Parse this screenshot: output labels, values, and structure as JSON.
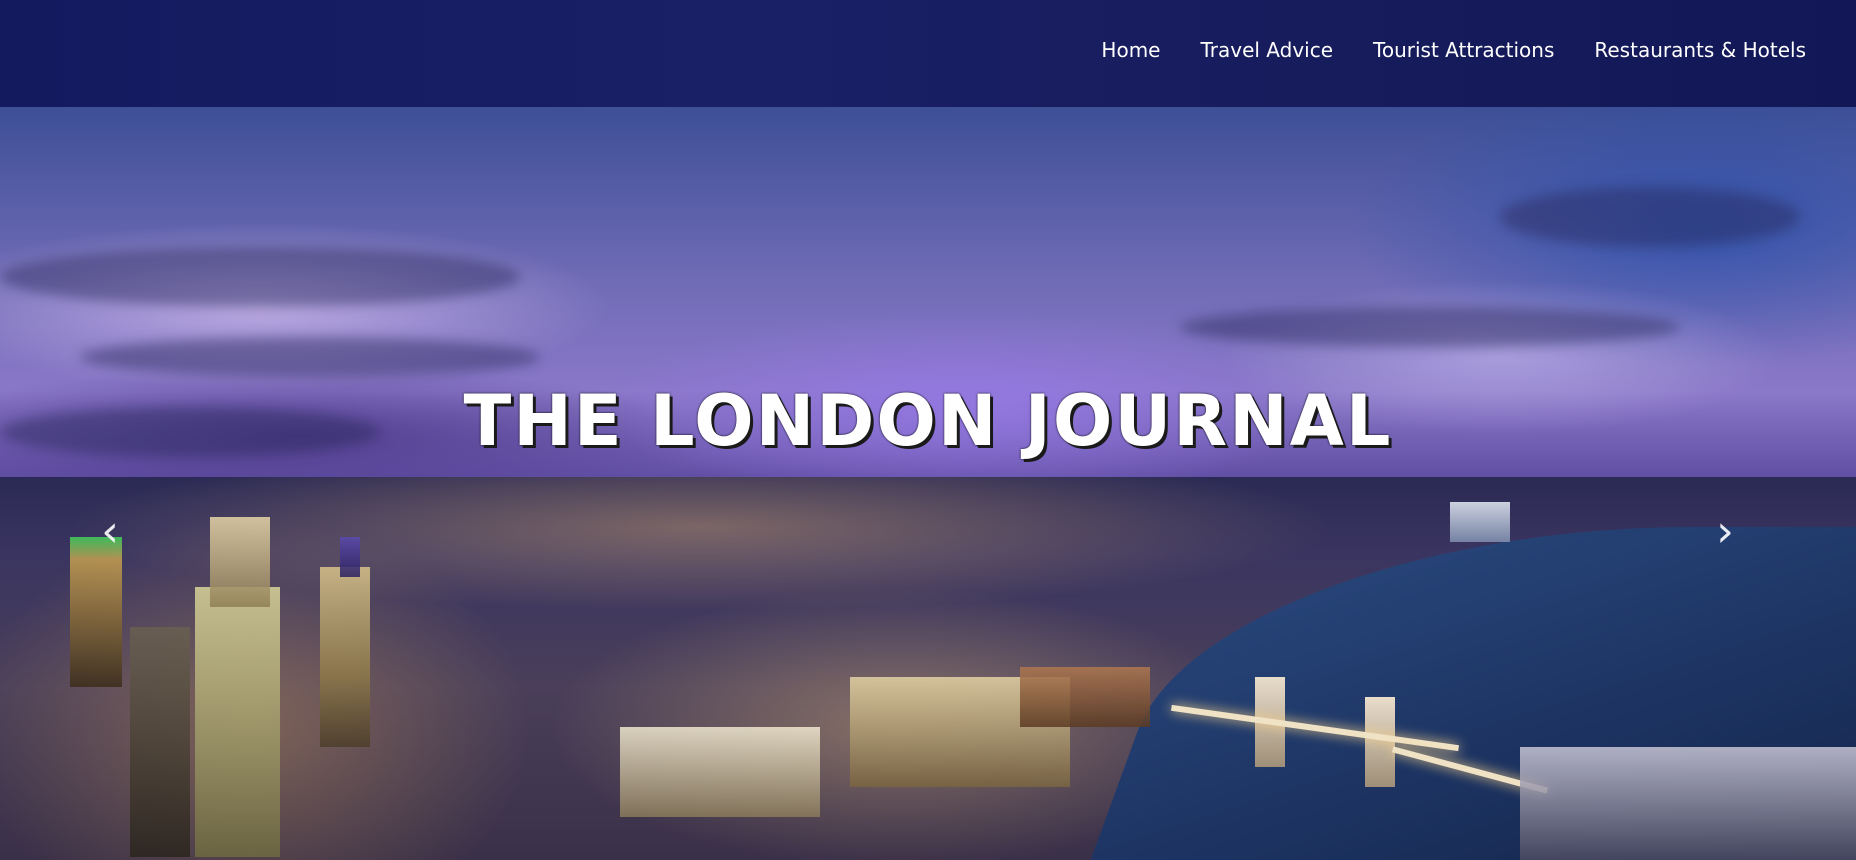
{
  "nav": {
    "items": [
      {
        "label": "Home"
      },
      {
        "label": "Travel Advice"
      },
      {
        "label": "Tourist Attractions"
      },
      {
        "label": "Restaurants & Hotels"
      }
    ]
  },
  "hero": {
    "title": "THE LONDON JOURNAL",
    "prev_icon": "chevron-left-icon",
    "next_icon": "chevron-right-icon",
    "prev_glyph": "‹",
    "next_glyph": "›"
  },
  "colors": {
    "navbar": "#161c5c",
    "text": "#ffffff"
  }
}
